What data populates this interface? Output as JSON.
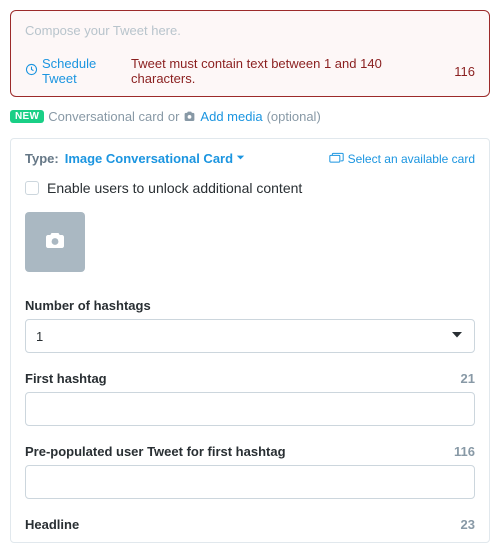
{
  "compose": {
    "placeholder": "Compose your Tweet here.",
    "schedule_label": "Schedule Tweet",
    "error_msg": "Tweet must contain text between 1 and 140 characters.",
    "char_count": "116"
  },
  "cardline": {
    "new_badge": "NEW",
    "conv_card": "Conversational card",
    "or": "or",
    "add_media": "Add media",
    "optional": "(optional)"
  },
  "card_header": {
    "type_label": "Type:",
    "type_value": "Image Conversational Card",
    "select_card": "Select an available card"
  },
  "enable_label": "Enable users to unlock additional content",
  "fields": {
    "num_hashtags": {
      "label": "Number of hashtags",
      "value": "1"
    },
    "first_hashtag": {
      "label": "First hashtag",
      "count": "21"
    },
    "pre_pop": {
      "label": "Pre-populated user Tweet for first hashtag",
      "count": "116"
    },
    "headline": {
      "label": "Headline",
      "count": "23"
    }
  }
}
